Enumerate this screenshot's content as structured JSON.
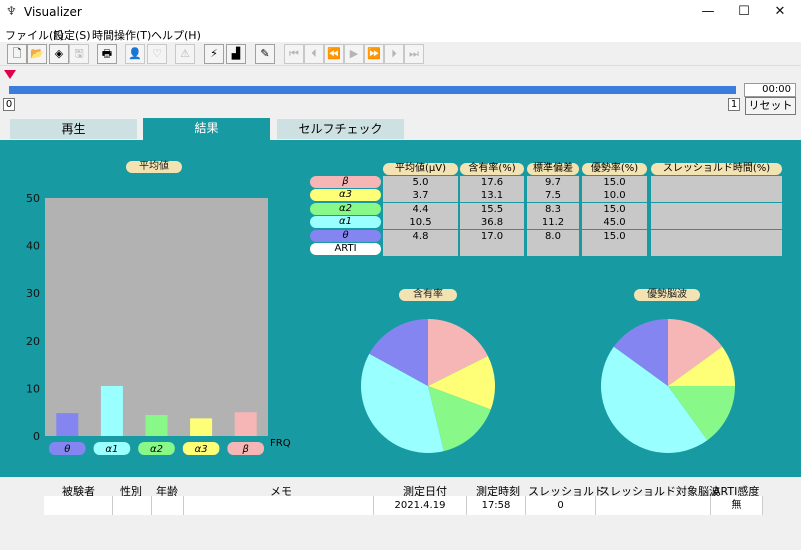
{
  "window": {
    "title": "Visualizer",
    "minimize": "—",
    "maximize": "☐",
    "close": "✕"
  },
  "menu": [
    "ファイル(F)",
    "設定(S)",
    "時間操作(T)",
    "ヘルプ(H)"
  ],
  "toolbar": [
    {
      "name": "new-file-icon",
      "glyph": "🗋",
      "enabled": true
    },
    {
      "name": "open-folder-icon",
      "glyph": "📂",
      "enabled": true
    },
    {
      "name": "layers-icon",
      "glyph": "◈",
      "enabled": true
    },
    {
      "name": "save-icon",
      "glyph": "🖫",
      "enabled": false
    },
    {
      "name": "print-icon",
      "glyph": "🖶",
      "enabled": true
    },
    {
      "name": "person-icon",
      "glyph": "👤",
      "enabled": false
    },
    {
      "name": "heart-icon",
      "glyph": "♡",
      "enabled": false
    },
    {
      "name": "alert-icon",
      "glyph": "⚠",
      "enabled": false
    },
    {
      "name": "lightning-icon",
      "glyph": "⚡",
      "enabled": true
    },
    {
      "name": "bar-chart-icon",
      "glyph": "▟",
      "enabled": true
    },
    {
      "name": "brush-icon",
      "glyph": "✎",
      "enabled": true
    },
    {
      "name": "skip-first-icon",
      "glyph": "⏮",
      "enabled": false
    },
    {
      "name": "step-back-icon",
      "glyph": "⏴",
      "enabled": false
    },
    {
      "name": "rewind-icon",
      "glyph": "⏪",
      "enabled": false
    },
    {
      "name": "play-icon",
      "glyph": "▶",
      "enabled": false
    },
    {
      "name": "fast-forward-icon",
      "glyph": "⏩",
      "enabled": false
    },
    {
      "name": "step-forward-icon",
      "glyph": "⏵",
      "enabled": false
    },
    {
      "name": "skip-last-icon",
      "glyph": "⏭",
      "enabled": false
    }
  ],
  "playback": {
    "time": "00:00",
    "start_label": "0",
    "end_label": "1",
    "reset_label": "リセット",
    "progress": 1.0
  },
  "tabs": [
    "再生",
    "結果",
    "セルフチェック"
  ],
  "colors": {
    "theta": "#8585f2",
    "alpha1": "#99ffff",
    "alpha2": "#88f988",
    "alpha3": "#ffff77",
    "beta": "#f6b6b6",
    "bg": "#179aa2"
  },
  "bar_chart_title": "平均値",
  "table_headers": [
    "平均値(μV)",
    "含有率(%)",
    "標準偏差",
    "優勢率(%)",
    "スレッショルド時間(%)"
  ],
  "table_rows": [
    {
      "label": "β",
      "color": "#f6b6b6",
      "values": [
        "5.0",
        "17.6",
        "9.7",
        "15.0",
        ""
      ]
    },
    {
      "label": "α3",
      "color": "#ffff77",
      "values": [
        "3.7",
        "13.1",
        "7.5",
        "10.0",
        ""
      ]
    },
    {
      "label": "α2",
      "color": "#88f988",
      "values": [
        "4.4",
        "15.5",
        "8.3",
        "15.0",
        ""
      ]
    },
    {
      "label": "α1",
      "color": "#99ffff",
      "values": [
        "10.5",
        "36.8",
        "11.2",
        "45.0",
        ""
      ]
    },
    {
      "label": "θ",
      "color": "#8585f2",
      "values": [
        "4.8",
        "17.0",
        "8.0",
        "15.0",
        ""
      ]
    },
    {
      "label": "ARTI",
      "color": "#ffffff",
      "values": [
        "",
        "",
        "",
        "",
        ""
      ]
    }
  ],
  "pie1_title": "含有率",
  "pie2_title": "優勢脳波",
  "chart_data": [
    {
      "type": "bar",
      "title": "平均値",
      "categories": [
        "θ",
        "α1",
        "α2",
        "α3",
        "β"
      ],
      "values": [
        4.8,
        10.5,
        4.4,
        3.7,
        5.0
      ],
      "colors": [
        "#8585f2",
        "#99ffff",
        "#88f988",
        "#ffff77",
        "#f6b6b6"
      ],
      "xlabel": "FRQ",
      "ylim": [
        0,
        50
      ],
      "yticks": [
        0,
        10,
        20,
        30,
        40,
        50
      ]
    },
    {
      "type": "pie",
      "title": "含有率",
      "labels": [
        "β",
        "α3",
        "α2",
        "α1",
        "θ"
      ],
      "values": [
        17.6,
        13.1,
        15.5,
        36.8,
        17.0
      ],
      "colors": [
        "#f6b6b6",
        "#ffff77",
        "#88f988",
        "#99ffff",
        "#8585f2"
      ]
    },
    {
      "type": "pie",
      "title": "優勢脳波",
      "labels": [
        "β",
        "α3",
        "α2",
        "α1",
        "θ"
      ],
      "values": [
        15.0,
        10.0,
        15.0,
        45.0,
        15.0
      ],
      "colors": [
        "#f6b6b6",
        "#ffff77",
        "#88f988",
        "#99ffff",
        "#8585f2"
      ]
    }
  ],
  "bottom_table": {
    "headers": [
      "被験者",
      "性別",
      "年齢",
      "メモ",
      "測定日付",
      "測定時刻",
      "スレッショルド",
      "スレッショルド対象脳波",
      "ARTI感度"
    ],
    "values": [
      "",
      "",
      "",
      "",
      "2021.4.19",
      "17:58",
      "0",
      "",
      "無"
    ]
  }
}
